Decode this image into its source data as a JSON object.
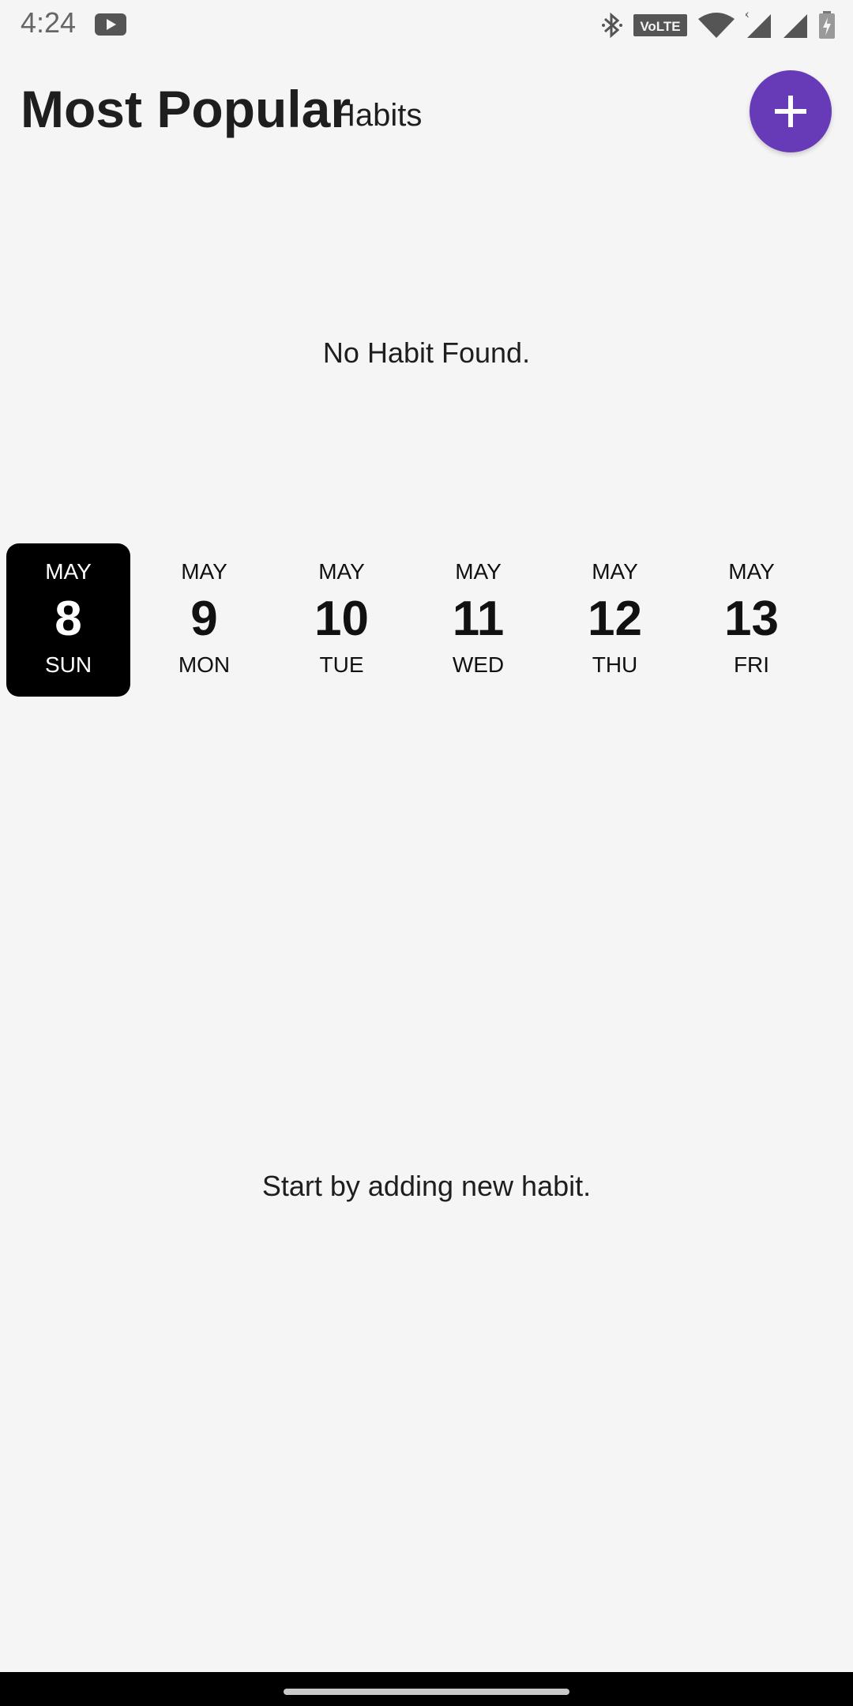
{
  "status_bar": {
    "time": "4:24",
    "icons": [
      "youtube-icon",
      "bluetooth-icon",
      "volte-icon",
      "wifi-icon",
      "signal-icon",
      "signal-icon",
      "battery-icon"
    ],
    "volte_label": "VoLTE"
  },
  "header": {
    "title": "Most Popular",
    "subtitle": "Habits",
    "add_button_icon": "plus-icon",
    "accent_color": "#673ab7"
  },
  "habits": {
    "empty_message": "No Habit Found."
  },
  "date_strip": {
    "selected_index": 0,
    "days": [
      {
        "month": "MAY",
        "day": "8",
        "weekday": "SUN"
      },
      {
        "month": "MAY",
        "day": "9",
        "weekday": "MON"
      },
      {
        "month": "MAY",
        "day": "10",
        "weekday": "TUE"
      },
      {
        "month": "MAY",
        "day": "11",
        "weekday": "WED"
      },
      {
        "month": "MAY",
        "day": "12",
        "weekday": "THU"
      },
      {
        "month": "MAY",
        "day": "13",
        "weekday": "FRI"
      }
    ]
  },
  "progress": {
    "empty_message": "Start by adding new habit."
  }
}
